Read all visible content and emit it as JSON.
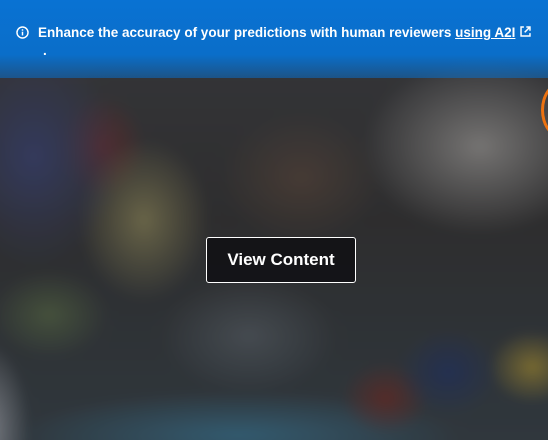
{
  "banner": {
    "text": "Enhance the accuracy of your predictions with human reviewers ",
    "link_text": "using A2I",
    "trailing": "."
  },
  "content": {
    "view_button_label": "View Content"
  },
  "icons": {
    "info": "info-icon",
    "external": "external-link-icon"
  },
  "colors": {
    "banner_bg": "#0972d3",
    "accent_ring": "#ec7211",
    "button_border": "#ffffff"
  }
}
